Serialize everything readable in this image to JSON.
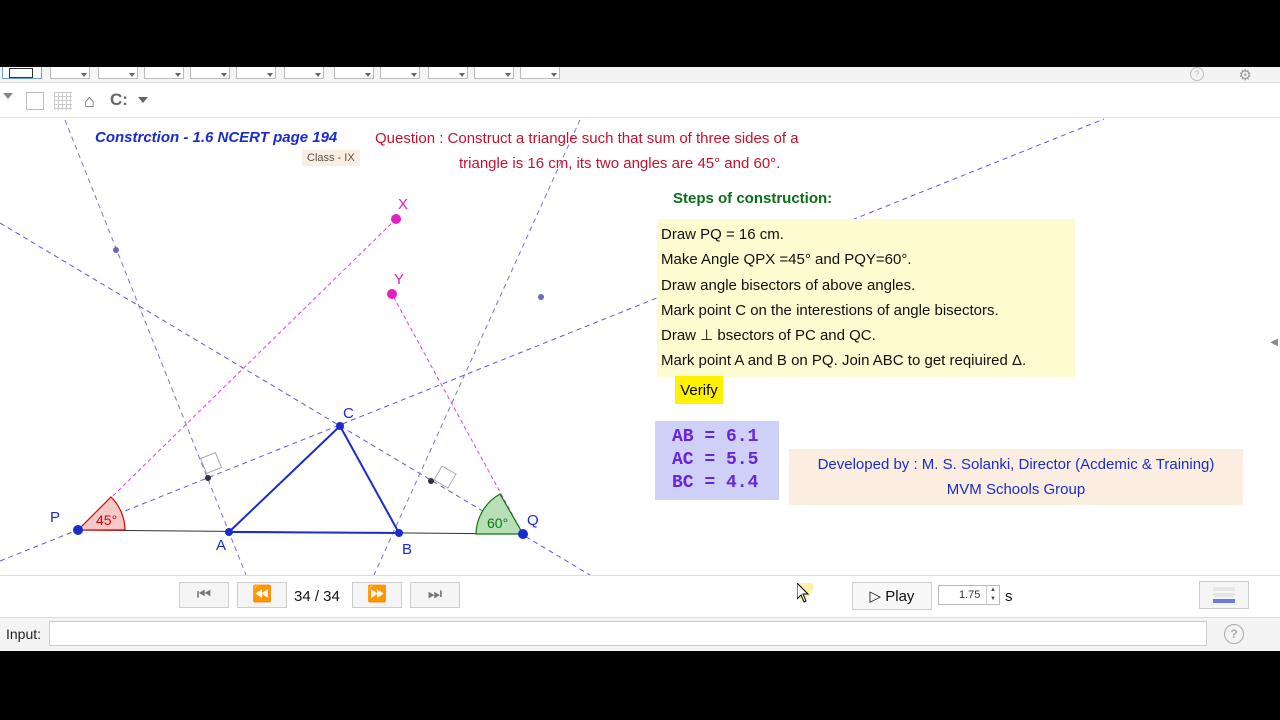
{
  "title": "Constrction - 1.6 NCERT page 194",
  "class_label": "Class - IX",
  "question": {
    "line1": "Question : Construct a triangle such that sum of three sides of a",
    "line2": "triangle is 16 cm,  its two angles are 45° and 60°."
  },
  "steps": {
    "heading": "Steps of construction:",
    "items": [
      "Draw PQ = 16 cm.",
      "Make Angle QPX =45° and PQY=60°.",
      "Draw angle bisectors of above angles.",
      "Mark point C on the interestions of angle bisectors.",
      "Draw ⊥ bsectors of PC and QC.",
      "Mark point A and B on PQ. Join ABC to get reqiuired Δ."
    ]
  },
  "verify_label": "Verify",
  "measurements": [
    {
      "text": "AB = 6.1",
      "value": 6.1
    },
    {
      "text": "AC = 5.5",
      "value": 5.5
    },
    {
      "text": "BC = 4.4",
      "value": 4.4
    }
  ],
  "credit": {
    "line1": "Developed by : M. S. Solanki, Director (Acdemic & Training)",
    "line2": "MVM Schools Group"
  },
  "points": {
    "P": "P",
    "Q": "Q",
    "A": "A",
    "B": "B",
    "C": "C",
    "X": "X",
    "Y": "Y"
  },
  "angles": {
    "P": "45°",
    "Q": "60°"
  },
  "navigation": {
    "first_icon": "skip-first-icon",
    "prev_icon": "rewind-icon",
    "next_icon": "fast-forward-icon",
    "last_icon": "skip-last-icon",
    "counter": "34 / 34",
    "play_label": "▷ Play",
    "speed": "1.75",
    "speed_unit": "s"
  },
  "input": {
    "label": "Input:",
    "value": ""
  },
  "colors": {
    "point": "#1a2ccc",
    "triangle": "#1a2ccc",
    "construction_blue": "#5a5ad8",
    "construction_pink": "#e040e0",
    "angle_p": "#e00000",
    "angle_q": "#0a7a0a",
    "question": "#c8102e",
    "heading": "#0a6e1a",
    "verify": "#fff200",
    "measure": "#6a24d8"
  }
}
